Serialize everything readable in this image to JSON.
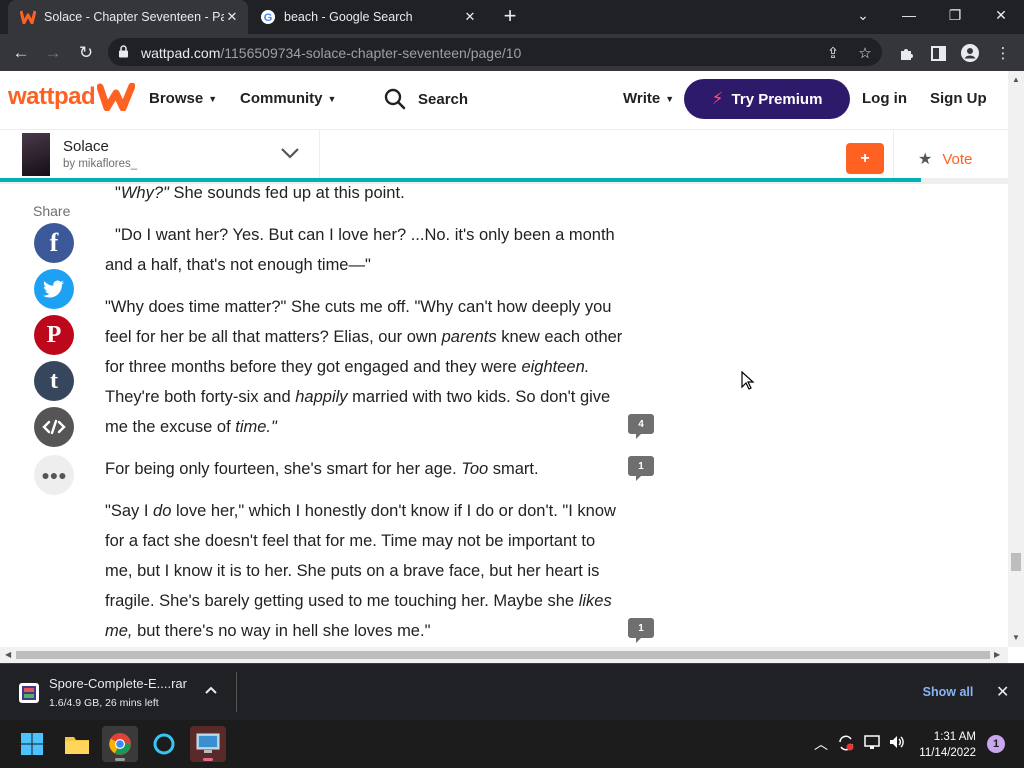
{
  "browser": {
    "tabs": [
      {
        "title": "Solace - Chapter Seventeen - Pag",
        "favicon": "wattpad-icon",
        "active": true
      },
      {
        "title": "beach - Google Search",
        "favicon": "google-icon",
        "active": false
      }
    ],
    "new_tab": "+",
    "url_domain": "wattpad.com",
    "url_path": "/1156509734-solace-chapter-seventeen/page/10"
  },
  "header": {
    "logo": "wattpad",
    "browse": "Browse",
    "community": "Community",
    "search": "Search",
    "write": "Write",
    "try_premium": "Try Premium",
    "login": "Log in",
    "signup": "Sign Up"
  },
  "story": {
    "title": "Solace",
    "author": "by mikaflores_",
    "add": "+",
    "vote": "Vote",
    "reading_progress": 0.914
  },
  "share": {
    "label": "Share",
    "buttons": [
      "facebook-icon",
      "twitter-icon",
      "pinterest-icon",
      "tumblr-icon",
      "embed-icon",
      "more-icon"
    ]
  },
  "paragraphs": {
    "p1": {
      "a": "\"",
      "b": "Why?\"",
      "c": " She sounds fed up at this point."
    },
    "p2": {
      "a": "\"Do I want her? Yes. But can I love her? ...No. it's only been a month and a half, that's not enough time—\""
    },
    "p3": {
      "a": "\"Why does time matter?\" She cuts me off. \"Why can't how deeply you feel for her be all that matters? Elias, our own ",
      "b": "parents",
      "c": " knew each other for three months before they got engaged and they were ",
      "d": "eighteen.",
      "e": " They're both forty-six and ",
      "f": "happily",
      "g": " married with two kids. So don't give me the excuse of ",
      "h": "time.\""
    },
    "p4": {
      "a": "For being only fourteen, she's smart for her age. ",
      "b": "Too",
      "c": " smart."
    },
    "p5": {
      "a": "\"Say I ",
      "b": "do",
      "c": " love her,\" which I honestly don't know if I do or don't. \"I know for a fact she doesn't feel that for me. Time may not be important to me, but I know it is to her. She puts on a brave face, but her heart is fragile. She's barely getting used to me touching her. Maybe she ",
      "d": "likes me,",
      "e": " but there's no way in hell she loves me.\""
    }
  },
  "comments": {
    "p3": "4",
    "p4": "1",
    "p5": "1"
  },
  "download": {
    "file": "Spore-Complete-E....rar",
    "status": "1.6/4.9 GB, 26 mins left",
    "show_all": "Show all"
  },
  "taskbar": {
    "time": "1:31 AM",
    "date": "11/14/2022",
    "notifications": "1"
  },
  "colors": {
    "brand": "#ff6122",
    "premium": "#2e1a6b",
    "progress": "#00b2b2"
  }
}
